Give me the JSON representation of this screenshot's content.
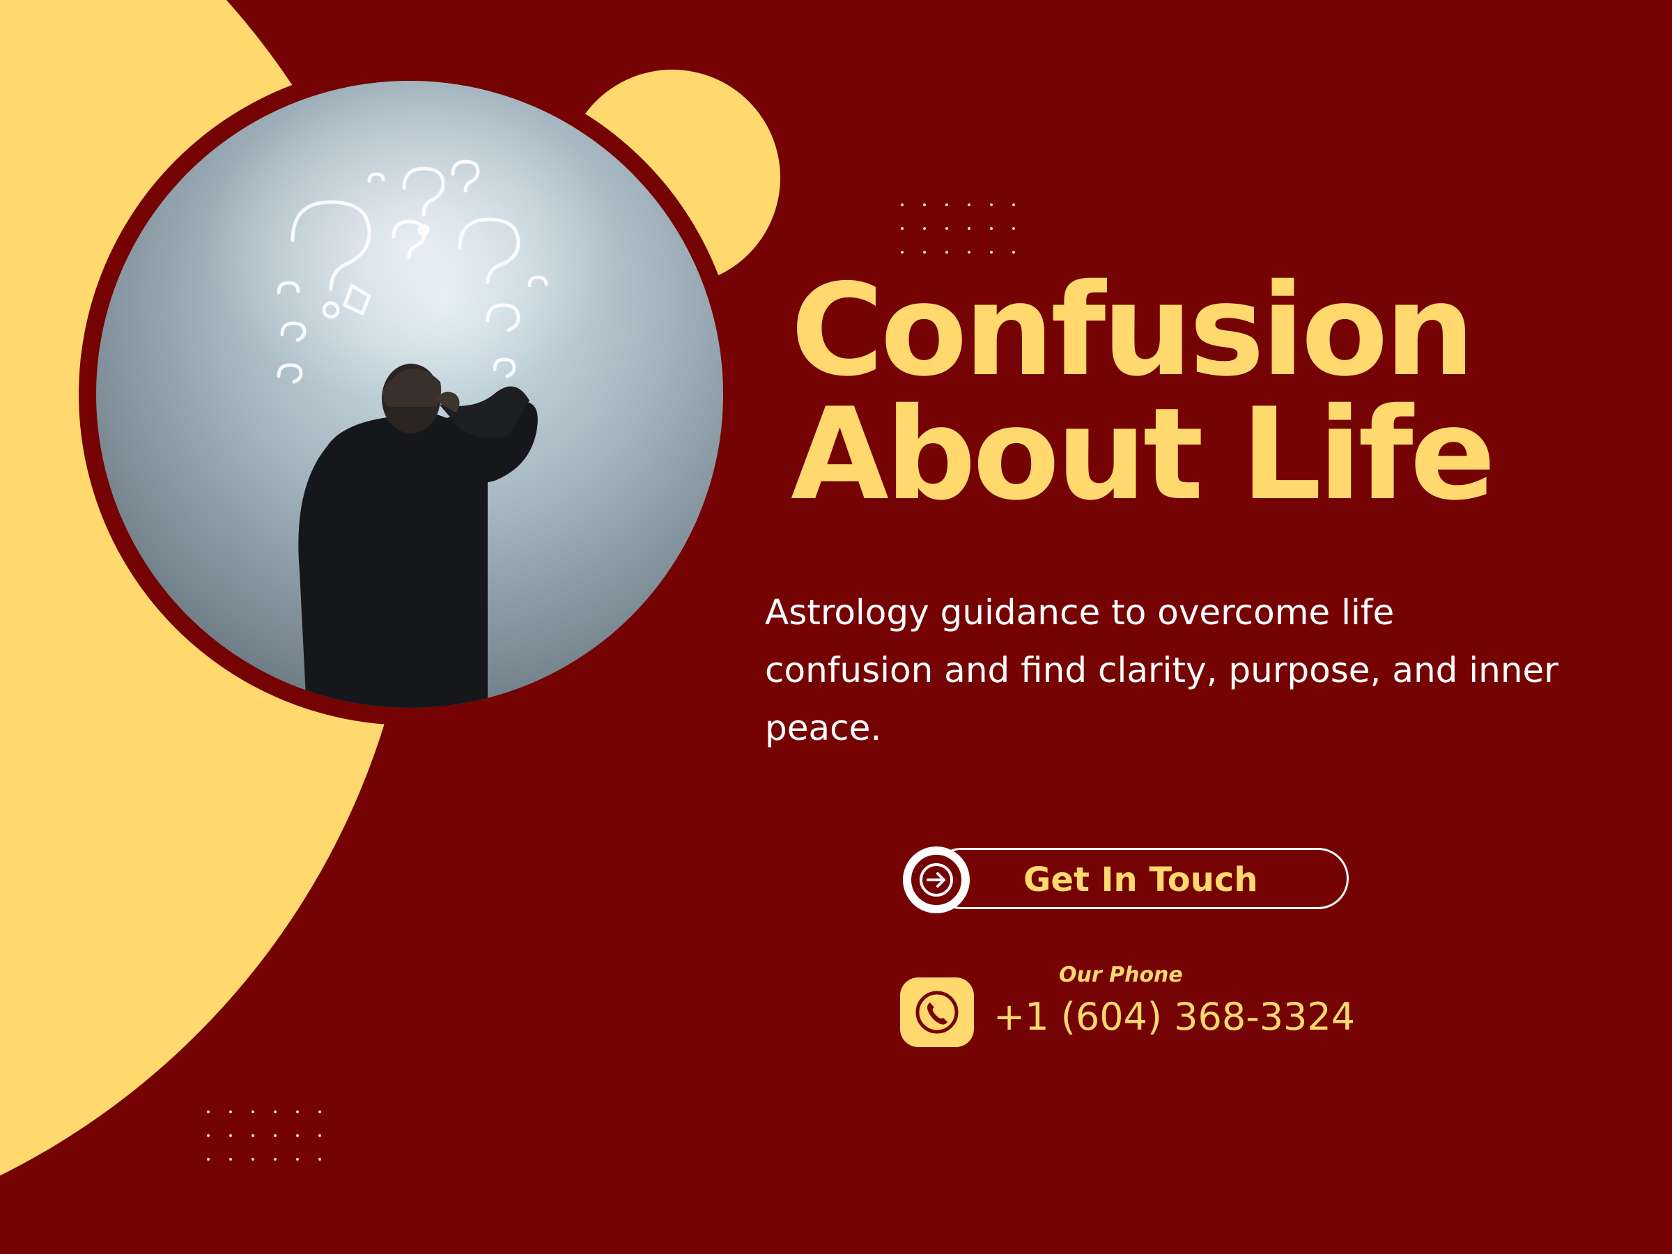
{
  "hero": {
    "headline_line1": "Confusion",
    "headline_line2": "About Life",
    "description": "Astrology guidance to overcome life confusion and find clarity, purpose, and inner peace."
  },
  "cta": {
    "label": "Get In Touch",
    "icon": "arrow-right-icon"
  },
  "contact": {
    "caption": "Our Phone",
    "phone": "+1 (604) 368-3324",
    "icon": "phone-icon"
  },
  "colors": {
    "background": "#760303",
    "accent": "#FFD96E",
    "text": "#FFFFFF"
  }
}
